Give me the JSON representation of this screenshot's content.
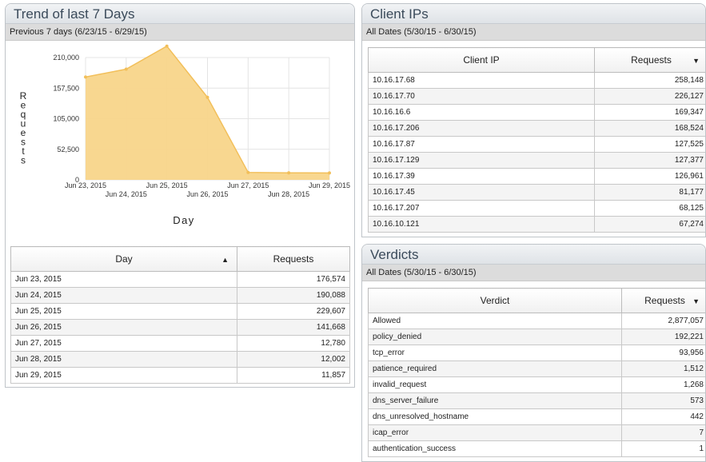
{
  "trend": {
    "title": "Trend of last 7 Days",
    "subtitle": "Previous 7 days (6/23/15 - 6/29/15)",
    "table": {
      "columns": [
        "Day",
        "Requests"
      ],
      "rows": [
        [
          "Jun 23, 2015",
          "176,574"
        ],
        [
          "Jun 24, 2015",
          "190,088"
        ],
        [
          "Jun 25, 2015",
          "229,607"
        ],
        [
          "Jun 26, 2015",
          "141,668"
        ],
        [
          "Jun 27, 2015",
          "12,780"
        ],
        [
          "Jun 28, 2015",
          "12,002"
        ],
        [
          "Jun 29, 2015",
          "11,857"
        ]
      ]
    }
  },
  "client_ips": {
    "title": "Client IPs",
    "subtitle": "All Dates (5/30/15 - 6/30/15)",
    "table": {
      "columns": [
        "Client IP",
        "Requests"
      ],
      "rows": [
        [
          "10.16.17.68",
          "258,148"
        ],
        [
          "10.16.17.70",
          "226,127"
        ],
        [
          "10.16.16.6",
          "169,347"
        ],
        [
          "10.16.17.206",
          "168,524"
        ],
        [
          "10.16.17.87",
          "127,525"
        ],
        [
          "10.16.17.129",
          "127,377"
        ],
        [
          "10.16.17.39",
          "126,961"
        ],
        [
          "10.16.17.45",
          "81,177"
        ],
        [
          "10.16.17.207",
          "68,125"
        ],
        [
          "10.16.10.121",
          "67,274"
        ]
      ]
    }
  },
  "verdicts": {
    "title": "Verdicts",
    "subtitle": "All Dates (5/30/15 - 6/30/15)",
    "table": {
      "columns": [
        "Verdict",
        "Requests"
      ],
      "rows": [
        [
          "Allowed",
          "2,877,057"
        ],
        [
          "policy_denied",
          "192,221"
        ],
        [
          "tcp_error",
          "93,956"
        ],
        [
          "patience_required",
          "1,512"
        ],
        [
          "invalid_request",
          "1,268"
        ],
        [
          "dns_server_failure",
          "573"
        ],
        [
          "dns_unresolved_hostname",
          "442"
        ],
        [
          "icap_error",
          "7"
        ],
        [
          "authentication_success",
          "1"
        ]
      ]
    }
  },
  "chart_data": {
    "type": "area",
    "x": [
      "Jun 23, 2015",
      "Jun 24, 2015",
      "Jun 25, 2015",
      "Jun 26, 2015",
      "Jun 27, 2015",
      "Jun 28, 2015",
      "Jun 29, 2015"
    ],
    "values": [
      176574,
      190088,
      229607,
      141668,
      12780,
      12002,
      11857
    ],
    "xlabel": "Day",
    "ylabel": "Requests",
    "yticks": [
      "0",
      "52,500",
      "105,000",
      "157,500",
      "210,000"
    ],
    "ylim": [
      0,
      210000
    ],
    "grid": true,
    "fill_color": "#f8d58a",
    "line_color": "#f2bf5a"
  }
}
